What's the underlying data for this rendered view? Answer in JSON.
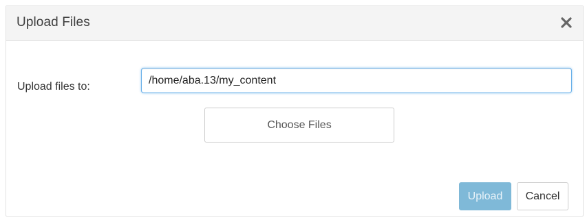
{
  "dialog": {
    "title": "Upload Files",
    "close_icon": "close-icon"
  },
  "form": {
    "label": "Upload files to:",
    "path_value": "/home/aba.13/my_content"
  },
  "buttons": {
    "choose_files": "Choose Files",
    "upload": "Upload",
    "cancel": "Cancel"
  },
  "colors": {
    "header_bg": "#f4f4f4",
    "input_focus": "#66afe9",
    "upload_disabled": "#7fb9d8"
  }
}
